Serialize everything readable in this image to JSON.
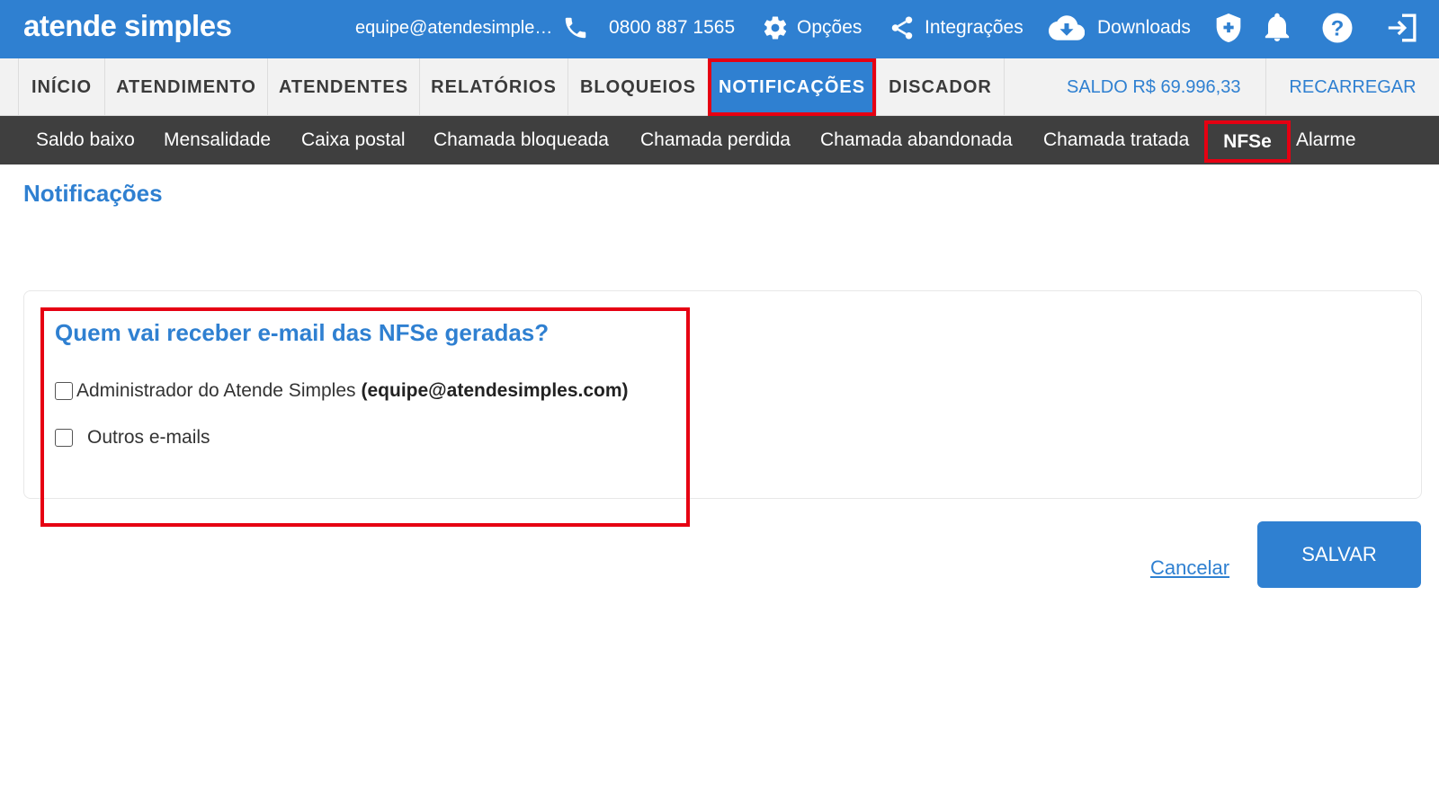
{
  "header": {
    "logo": "atende simples",
    "email": "equipe@atendesimple…",
    "phone": "0800 887 1565",
    "opcoes": "Opções",
    "integracoes": "Integrações",
    "downloads": "Downloads",
    "icons": [
      "phone-icon",
      "gear-icon",
      "share-icon",
      "cloud-download-icon",
      "shield-icon",
      "bell-icon",
      "help-icon",
      "logout-icon"
    ]
  },
  "nav": {
    "items": [
      "INÍCIO",
      "ATENDIMENTO",
      "ATENDENTES",
      "RELATÓRIOS",
      "BLOQUEIOS",
      "NOTIFICAÇÕES",
      "DISCADOR"
    ],
    "active": "NOTIFICAÇÕES",
    "saldo": "SALDO R$ 69.996,33",
    "recarregar": "RECARREGAR"
  },
  "subnav": {
    "items": [
      "Saldo baixo",
      "Mensalidade",
      "Caixa postal",
      "Chamada bloqueada",
      "Chamada perdida",
      "Chamada abandonada",
      "Chamada tratada",
      "NFSe",
      "Alarme"
    ],
    "active": "NFSe"
  },
  "page": {
    "title": "Notificações",
    "question": "Quem vai receber e-mail das NFSe geradas?",
    "option_admin_label": "Administrador do Atende Simples",
    "option_admin_email": "(equipe@atendesimples.com)",
    "option_admin_checked": false,
    "option_outros_label": "Outros e-mails",
    "option_outros_checked": false
  },
  "actions": {
    "cancel": "Cancelar",
    "save": "SALVAR"
  },
  "colors": {
    "primary": "#2f80d1",
    "subnav_bg": "#3f3f3f",
    "highlight": "#e60012"
  }
}
